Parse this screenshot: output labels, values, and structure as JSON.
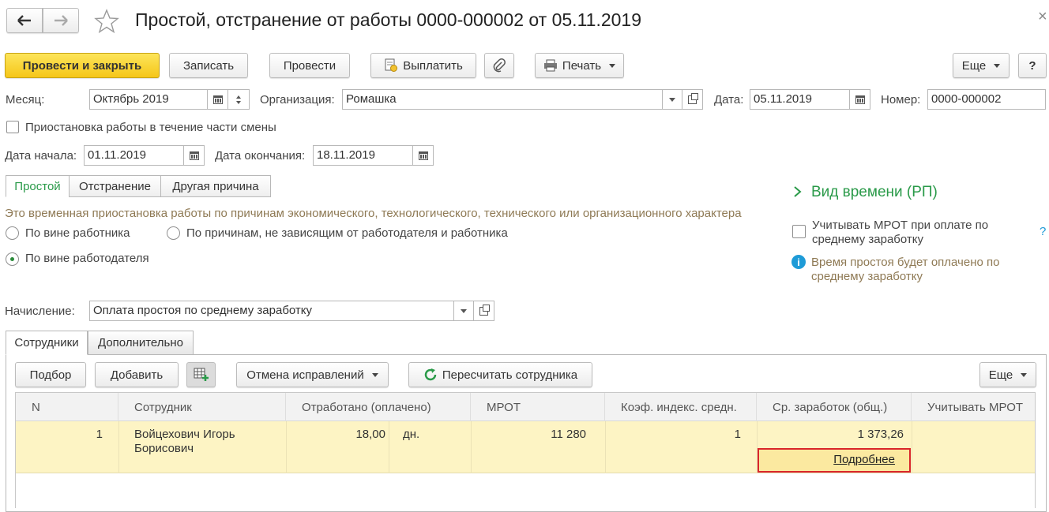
{
  "window": {
    "title": "Простой, отстранение от работы 0000-000002 от 05.11.2019",
    "close_glyph": "×"
  },
  "toolbar": {
    "post_close": "Провести и закрыть",
    "save": "Записать",
    "post": "Провести",
    "pay": "Выплатить",
    "print": "Печать",
    "more": "Еще",
    "help": "?"
  },
  "header": {
    "month_label": "Месяц:",
    "month_value": "Октябрь 2019",
    "org_label": "Организация:",
    "org_value": "Ромашка",
    "date_label": "Дата:",
    "date_value": "05.11.2019",
    "number_label": "Номер:",
    "number_value": "0000-000002"
  },
  "partial_shift_label": "Приостановка работы в течение части смены",
  "period": {
    "start_label": "Дата начала:",
    "start_value": "01.11.2019",
    "end_label": "Дата окончания:",
    "end_value": "18.11.2019"
  },
  "reason_tabs": [
    "Простой",
    "Отстранение",
    "Другая причина"
  ],
  "description": "Это временная приостановка работы по причинам экономического, технологического, технического или организационного характера",
  "fault": {
    "employee": "По вине работника",
    "independent": "По причинам, не зависящим от работодателя и работника",
    "employer": "По вине работодателя"
  },
  "side": {
    "time_type": "Вид времени (РП)",
    "mrot_line1": "Учитывать МРОТ при оплате по",
    "mrot_line2": "среднему заработку",
    "help": "?",
    "info_line1": "Время простоя будет оплачено по",
    "info_line2": "среднему заработку"
  },
  "accrual": {
    "label": "Начисление:",
    "value": "Оплата простоя по среднему заработку"
  },
  "main_tabs": [
    "Сотрудники",
    "Дополнительно"
  ],
  "table_toolbar": {
    "pick": "Подбор",
    "add": "Добавить",
    "cancel_fix": "Отмена исправлений",
    "recalc": "Пересчитать сотрудника",
    "more": "Еще"
  },
  "table": {
    "columns": [
      "N",
      "Сотрудник",
      "Отработано (оплачено)",
      "МРОТ",
      "Коэф. индекс. средн.",
      "Ср. заработок (общ.)",
      "Учитывать МРОТ"
    ],
    "rows": [
      {
        "n": "1",
        "employee_line1": "Войцехович Игорь",
        "employee_line2": "Борисович",
        "worked": "18,00",
        "unit": "дн.",
        "mrot": "11 280",
        "coef": "1",
        "avg": "1 373,26",
        "details": "Подробнее"
      }
    ]
  },
  "colors": {
    "accent_green": "#2a9a49",
    "primary_yellow": "#f5c619",
    "row_highlight": "#fdf4c4",
    "details_border": "#d9262b",
    "info_blue": "#1e9bd7"
  }
}
